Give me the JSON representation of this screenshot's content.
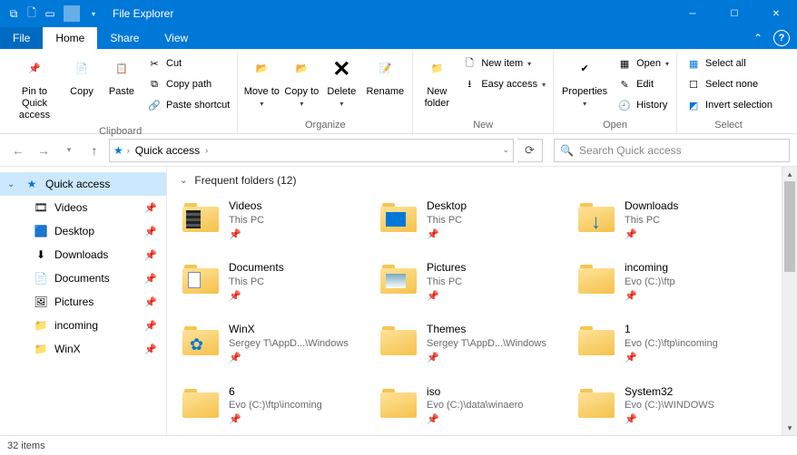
{
  "window": {
    "title": "File Explorer"
  },
  "tabs": {
    "file": "File",
    "home": "Home",
    "share": "Share",
    "view": "View"
  },
  "ribbon": {
    "clipboard": {
      "label": "Clipboard",
      "pin": "Pin to Quick access",
      "copy": "Copy",
      "paste": "Paste",
      "cut": "Cut",
      "copypath": "Copy path",
      "pasteshortcut": "Paste shortcut"
    },
    "organize": {
      "label": "Organize",
      "moveto": "Move to",
      "copyto": "Copy to",
      "delete": "Delete",
      "rename": "Rename"
    },
    "new": {
      "label": "New",
      "newfolder": "New folder",
      "newitem": "New item",
      "easyaccess": "Easy access"
    },
    "open": {
      "label": "Open",
      "properties": "Properties",
      "open": "Open",
      "edit": "Edit",
      "history": "History"
    },
    "select": {
      "label": "Select",
      "selectall": "Select all",
      "selectnone": "Select none",
      "invert": "Invert selection"
    }
  },
  "nav": {
    "quickaccess": "Quick access",
    "search_placeholder": "Search Quick access"
  },
  "tree": {
    "root": "Quick access",
    "items": [
      {
        "label": "Videos"
      },
      {
        "label": "Desktop"
      },
      {
        "label": "Downloads"
      },
      {
        "label": "Documents"
      },
      {
        "label": "Pictures"
      },
      {
        "label": "incoming"
      },
      {
        "label": "WinX"
      }
    ]
  },
  "group_header": "Frequent folders (12)",
  "folders": [
    {
      "name": "Videos",
      "sub": "This PC",
      "ov": "ov-film"
    },
    {
      "name": "Desktop",
      "sub": "This PC",
      "ov": "ov-desk"
    },
    {
      "name": "Downloads",
      "sub": "This PC",
      "ov": "ov-down",
      "glyph": "↓"
    },
    {
      "name": "Documents",
      "sub": "This PC",
      "ov": "ov-doc"
    },
    {
      "name": "Pictures",
      "sub": "This PC",
      "ov": "ov-pic"
    },
    {
      "name": "incoming",
      "sub": "Evo (C:)\\ftp",
      "ov": "ov-plain"
    },
    {
      "name": "WinX",
      "sub": "Sergey T\\AppD...\\Windows",
      "ov": "ov-gear",
      "glyph": "✿"
    },
    {
      "name": "Themes",
      "sub": "Sergey T\\AppD...\\Windows",
      "ov": "ov-plain"
    },
    {
      "name": "1",
      "sub": "Evo (C:)\\ftp\\incoming",
      "ov": "ov-plain"
    },
    {
      "name": "6",
      "sub": "Evo (C:)\\ftp\\incoming",
      "ov": "ov-plain"
    },
    {
      "name": "iso",
      "sub": "Evo (C:)\\data\\winaero",
      "ov": "ov-plain"
    },
    {
      "name": "System32",
      "sub": "Evo (C:)\\WINDOWS",
      "ov": "ov-plain"
    }
  ],
  "status": "32 items"
}
